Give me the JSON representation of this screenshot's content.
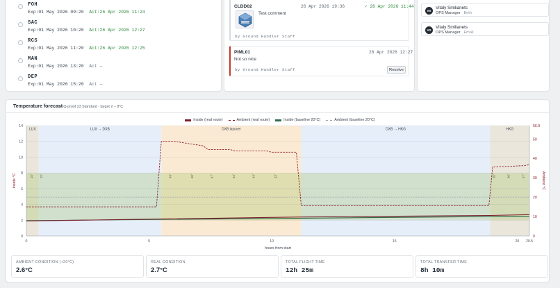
{
  "milestones": [
    {
      "code": "FOH",
      "exp": "Exp:01 May 2026 09:20",
      "act": "Act:26 Apr 2026 11:24",
      "done": true
    },
    {
      "code": "SAC",
      "exp": "Exp:01 May 2026 10:20",
      "act": "Act:26 Apr 2026 12:27",
      "done": true
    },
    {
      "code": "RCS",
      "exp": "Exp:01 May 2026 11:20",
      "act": "Act:26 Apr 2026 12:25",
      "done": true
    },
    {
      "code": "MAN",
      "exp": "Exp:01 May 2026 13:20",
      "act": "Act —",
      "done": false
    },
    {
      "code": "DEP",
      "exp": "Exp:01 May 2026 15:20",
      "act": "Act —",
      "done": false
    }
  ],
  "comments": [
    {
      "title": "CLDD02",
      "date": "26 Apr 2026 19:36",
      "resolved": "✓ 26 Apr 2026 11:44",
      "text": "Test comment",
      "by": "by Ground Handler Staff",
      "thumb_label": "ENVIROTAINER"
    },
    {
      "title": "PIML01",
      "date": "26 Apr 2026 12:27",
      "text": "Not so nice",
      "by": "by Ground Handler Staff",
      "resolve_label": "Resolve"
    }
  ],
  "recipients": [
    {
      "initials": "VS",
      "name": "Vitaly Smilianets",
      "role": "OPS Manager",
      "channel": "Both"
    },
    {
      "initials": "VS",
      "name": "Vitaly Smilianets",
      "role": "OPS Manager",
      "channel": "Email"
    }
  ],
  "forecast": {
    "title": "Temperature forecast",
    "subtitle": "va-Q-proof 23 Standard · target 2 – 8°C",
    "legend": [
      {
        "label": "Inside (real route)",
        "color": "#7a1d2a",
        "style": "solid"
      },
      {
        "label": "Ambient (real route)",
        "color": "#8b1f2b",
        "style": "dashed"
      },
      {
        "label": "Inside (baseline 20°C)",
        "color": "#2e6b4a",
        "style": "solid"
      },
      {
        "label": "Ambient (baseline 20°C)",
        "color": "#9ea6ad",
        "style": "dashed"
      }
    ]
  },
  "chart_data": {
    "type": "line",
    "xlabel": "hours from start",
    "ylabel_left": "Inside °C",
    "ylabel_right": "Ambient °C",
    "xlim": [
      0,
      20.5
    ],
    "x_ticks": [
      "0",
      "5",
      "10",
      "15",
      "20",
      "20.5"
    ],
    "ylim_left": [
      0,
      14
    ],
    "y_ticks_left": [
      "0",
      "2",
      "4",
      "6",
      "8",
      "10",
      "12",
      "14"
    ],
    "ylim_right": [
      0,
      56.9
    ],
    "y_ticks_right": [
      "0",
      "10",
      "20",
      "30",
      "40",
      "50",
      "56.9"
    ],
    "target_band": [
      2,
      8
    ],
    "phases": [
      {
        "label": "LUX",
        "x0": 0,
        "x1": 0.5,
        "color": "#eae6dc"
      },
      {
        "label": "LUX → DXB",
        "x0": 0.5,
        "x1": 5.5,
        "color": "#e6eefa"
      },
      {
        "label": "DXB layover",
        "x0": 5.5,
        "x1": 11.2,
        "color": "#fbead3"
      },
      {
        "label": "DXB → HKG",
        "x0": 11.2,
        "x1": 18.9,
        "color": "#e6eefa"
      },
      {
        "label": "HKG",
        "x0": 18.9,
        "x1": 20.5,
        "color": "#eae6dc"
      }
    ],
    "series": [
      {
        "name": "Inside (real route)",
        "x": [
          0,
          5.5,
          11.2,
          18.9,
          20.5
        ],
        "y": [
          1.9,
          2.15,
          2.4,
          2.6,
          2.7
        ]
      },
      {
        "name": "Ambient (real route)",
        "x": [
          0,
          5.3,
          5.5,
          6.0,
          7.2,
          7.4,
          8.3,
          8.5,
          9.8,
          10.0,
          11.0,
          11.2,
          18.85,
          19.0,
          20.3,
          20.5
        ],
        "y": [
          15,
          15,
          48.8,
          48.8,
          46.5,
          44.6,
          44.6,
          43.8,
          43.8,
          43.2,
          43.2,
          15.6,
          15.6,
          35.5,
          36.3,
          36.8
        ]
      },
      {
        "name": "Inside (baseline 20°C)",
        "x": [
          0,
          20.5
        ],
        "y": [
          1.95,
          2.5
        ]
      },
      {
        "name": "Ambient (baseline 20°C)",
        "x": [
          0,
          20.5
        ],
        "y": [
          20,
          20
        ]
      }
    ],
    "ambient_labels": [
      {
        "x": 0.25,
        "text": "15°"
      },
      {
        "x": 0.65,
        "text": "15°"
      },
      {
        "x": 5.9,
        "text": "49°"
      },
      {
        "x": 6.8,
        "text": "48°"
      },
      {
        "x": 7.6,
        "text": "47°"
      },
      {
        "x": 8.5,
        "text": "44°"
      },
      {
        "x": 9.3,
        "text": "44°"
      },
      {
        "x": 10.2,
        "text": "43°"
      },
      {
        "x": 19.1,
        "text": "35°"
      },
      {
        "x": 19.7,
        "text": "36°"
      },
      {
        "x": 20.3,
        "text": "37°"
      }
    ]
  },
  "stats": [
    {
      "label": "AMBIENT CONDITION (+20°C)",
      "value": "2.6°C",
      "mono": false
    },
    {
      "label": "REAL CONDITION",
      "value": "2.7°C",
      "mono": false
    },
    {
      "label": "TOTAL FLIGHT TIME",
      "value": "12h 25m",
      "mono": true
    },
    {
      "label": "TOTAL TRANSFER TIME",
      "value": "8h 10m",
      "mono": true
    }
  ]
}
